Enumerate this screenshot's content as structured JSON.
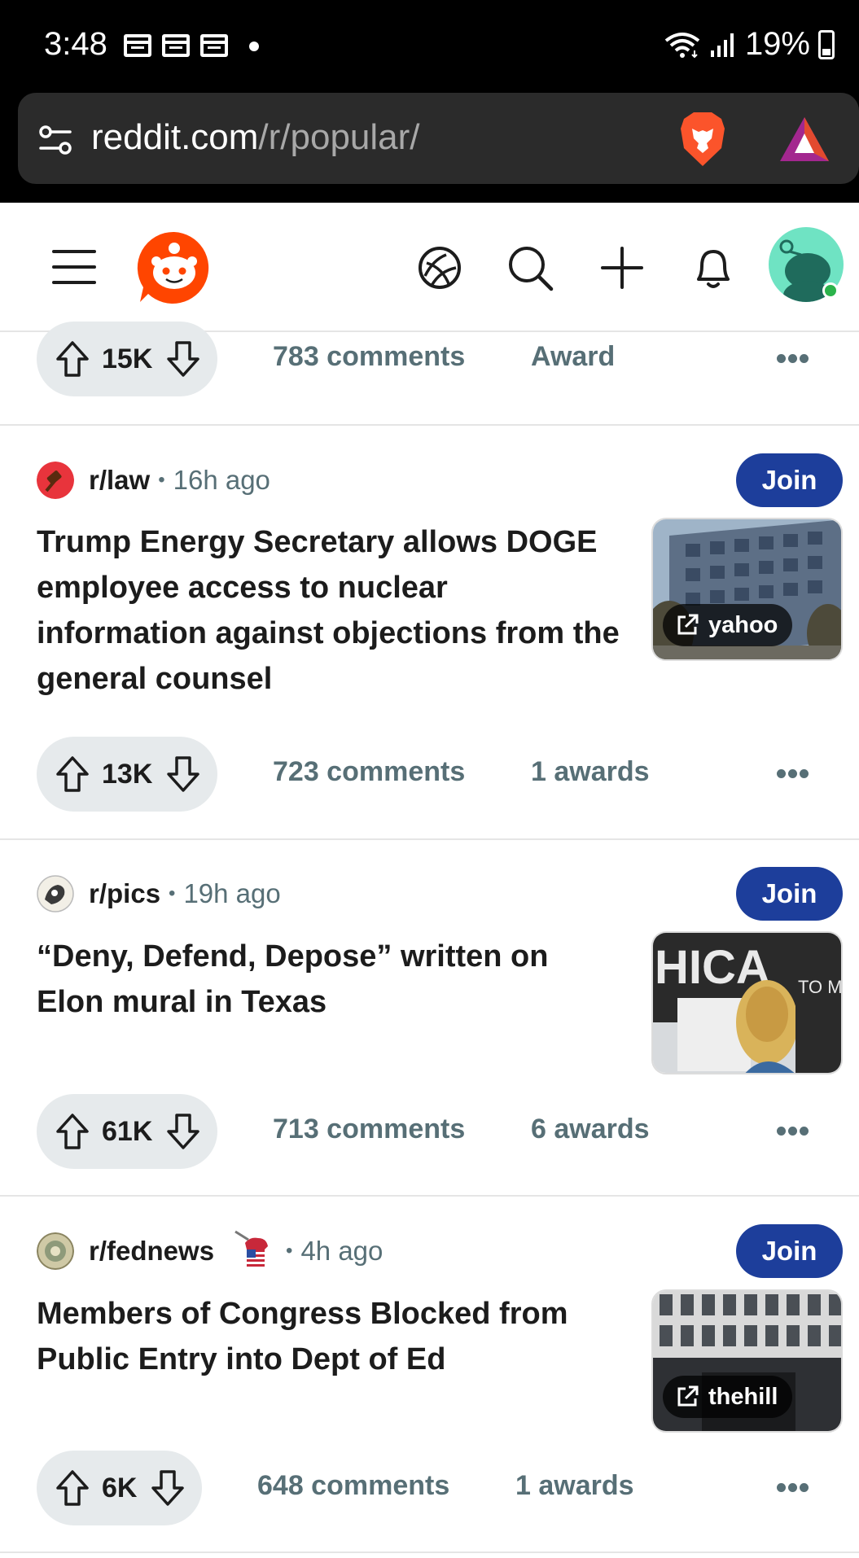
{
  "status_bar": {
    "time": "3:48",
    "battery": "19%"
  },
  "browser": {
    "url_domain": "reddit.com",
    "url_path": "/r/popular/"
  },
  "top_action_row": {
    "votes": "15K",
    "comments": "783 comments",
    "awards": "Award"
  },
  "posts": [
    {
      "subreddit": "r/law",
      "separator": "•",
      "time": "16h ago",
      "join": "Join",
      "title": "Trump Energy Secretary allows DOGE employee access to nuclear information against objections from the general counsel",
      "thumb_source": "yahoo",
      "votes": "13K",
      "comments": "723 comments",
      "awards": "1 awards"
    },
    {
      "subreddit": "r/pics",
      "separator": "•",
      "time": "19h ago",
      "join": "Join",
      "title": "“Deny, Defend, Depose” written on Elon mural in Texas",
      "votes": "61K",
      "comments": "713 comments",
      "awards": "6 awards"
    },
    {
      "subreddit": "r/fednews",
      "separator": "•",
      "time": "4h ago",
      "join": "Join",
      "title": "Members of Congress Blocked from Public Entry into Dept of Ed",
      "thumb_source": "thehill",
      "votes": "6K",
      "comments": "648 comments",
      "awards": "1 awards"
    }
  ],
  "colors": {
    "join_button": "#1d3e9b",
    "reddit_orange": "#ff4500",
    "meta_gray": "#576f76",
    "vote_pill": "#e6eaec"
  },
  "icons": [
    "settings-sliders-icon",
    "brave-lion-icon",
    "brave-rewards-icon",
    "menu-icon",
    "reddit-logo",
    "popular-icon",
    "search-icon",
    "plus-icon",
    "bell-icon",
    "upvote-icon",
    "downvote-icon",
    "more-icon",
    "external-link-icon"
  ]
}
